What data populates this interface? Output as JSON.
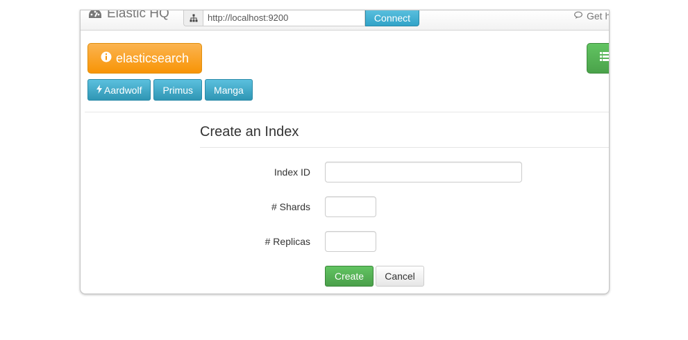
{
  "navbar": {
    "brand": "Elastic HQ",
    "brand_icon": "dashboard-icon",
    "url_icon": "sitemap-icon",
    "url_value": "http://localhost:9200",
    "connect_label": "Connect",
    "help_label": "Get h",
    "help_icon": "comments-icon"
  },
  "cluster": {
    "name": "elasticsearch",
    "name_icon": "info-icon",
    "status_color": "#f89406",
    "list_icon": "list-icon",
    "nodes": [
      {
        "label": "Aardwolf",
        "icon": "bolt-icon"
      },
      {
        "label": "Primus"
      },
      {
        "label": "Manga"
      }
    ]
  },
  "form": {
    "title": "Create an Index",
    "index_id_label": "Index ID",
    "index_id_value": "",
    "shards_label": "# Shards",
    "shards_value": "",
    "replicas_label": "# Replicas",
    "replicas_value": "",
    "create_label": "Create",
    "cancel_label": "Cancel"
  },
  "colors": {
    "primary_info": "#5bc0de",
    "success": "#5bb75b",
    "warning": "#f89406"
  }
}
